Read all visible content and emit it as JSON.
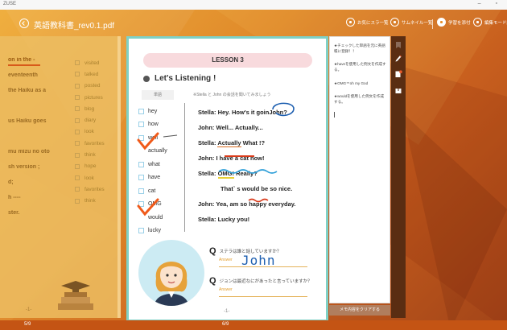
{
  "titlebar": {
    "app": "ZUSE",
    "controls": "– ▫"
  },
  "appbar": {
    "title": "英語教科書_rev0.1.pdf",
    "buttons": [
      {
        "label": "お気にスラ一覧",
        "icon": "bookmark-list-icon"
      },
      {
        "label": "サムネイル一覧",
        "icon": "thumbnail-icon"
      },
      {
        "label": "学習を添付",
        "icon": "check-circle-icon"
      },
      {
        "label": "編集モード終",
        "icon": "edit-mode-icon"
      }
    ]
  },
  "left_page": {
    "words": [
      "on in the -",
      "eventeenth",
      "the Haiku as a",
      "",
      "us Haiku goes",
      "",
      "mu mizu no oto",
      "sh version ;",
      "d;",
      "h ----",
      "ster."
    ],
    "list": [
      "visited",
      "talked",
      "posted",
      "pictures",
      "blog",
      "diary",
      "look",
      "favorites",
      "think",
      "hope",
      "look",
      "favorites",
      "think"
    ],
    "footnote": "-1-",
    "page_indicator": "5/9"
  },
  "page": {
    "lesson": "LESSON 3",
    "section": "Let's Listening !",
    "word_header": "単語",
    "instruction": "※Stella と John の会話を聞いてみましょう",
    "words": [
      "hey",
      "how",
      "well",
      "actually",
      "what",
      "have",
      "cat",
      "OMG",
      "would",
      "lucky"
    ],
    "dialog": [
      {
        "pre": "Stella: Hey. How's it goin",
        "mark": "John",
        "post": "?"
      },
      {
        "pre": "John: Well... Actually...",
        "mark": "",
        "post": ""
      },
      {
        "pre": "Stella: ",
        "mark": "Actually",
        "post": " What !?"
      },
      {
        "pre": "John: ",
        "mark": "I have a cat now!",
        "post": ""
      },
      {
        "pre": "Stella: ",
        "mark": "OMG!",
        "post": " Really?"
      },
      {
        "pre": "That` s ",
        "mark": "would",
        "post": " be so nice."
      },
      {
        "pre": "John: Yea, am so happy everyday.",
        "mark": "",
        "post": ""
      },
      {
        "pre": "Stella: Lucky you!",
        "mark": "",
        "post": ""
      }
    ],
    "q1": {
      "mark": "Q",
      "text": "ステラは誰と話していますか？",
      "answer_label": "Answer",
      "handwritten": "John"
    },
    "q2": {
      "mark": "Q",
      "text": "ジョンは最近なにがあったと言っていますか？",
      "answer_label": "Answer"
    },
    "page_number": "-1-"
  },
  "notes": {
    "items": [
      "★チェックした単語を元に英語帳に登録！！",
      "★haveを使用した例文を作成する。",
      "★OMG＝oh my God",
      "★wouldを使用した例文を作成する。"
    ],
    "clear_button": "メモ内容をクリアする"
  },
  "status": {
    "left": "5/9",
    "center": "6/9"
  },
  "colors": {
    "accent": "#e8902c",
    "page_border": "#7fd1c6",
    "lesson_bg": "#f8dadd",
    "check": "#f05a1a",
    "pen_blue": "#1e5fb0"
  }
}
